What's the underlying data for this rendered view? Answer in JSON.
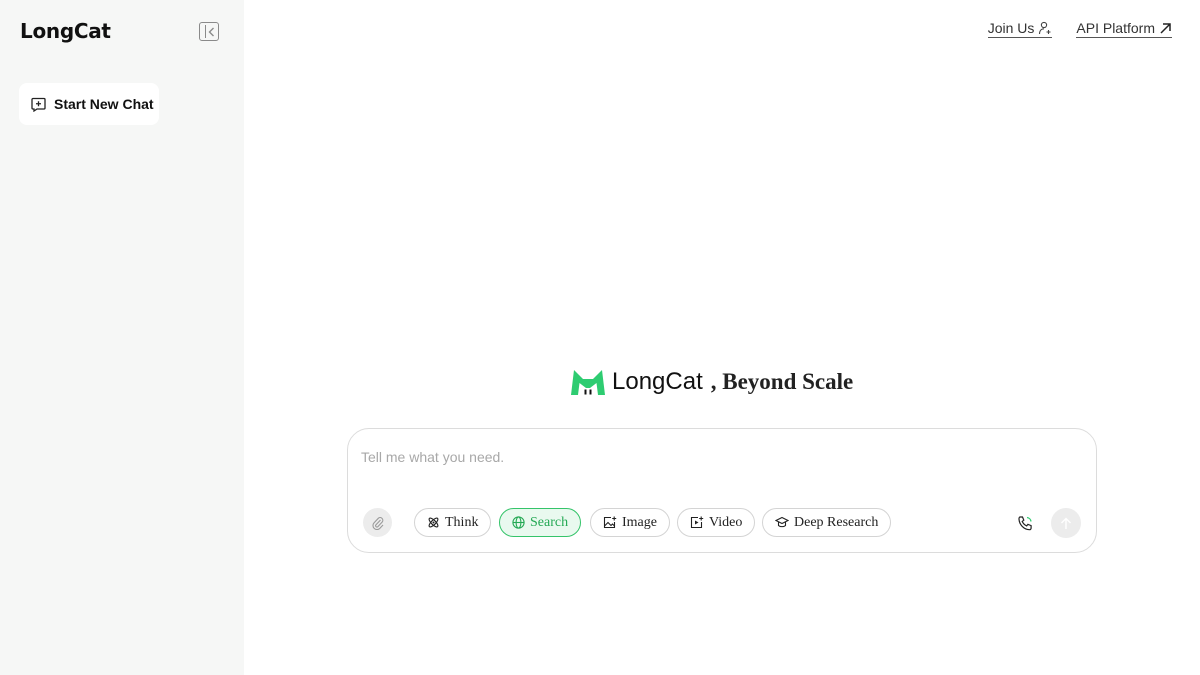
{
  "sidebar": {
    "brand": "LongCat",
    "collapse_icon": "sidebar-collapse-icon",
    "new_chat_label": "Start New Chat",
    "new_chat_icon": "plus-square-icon"
  },
  "topnav": {
    "links": [
      {
        "label": "Join Us",
        "icon": "user-plus-icon"
      },
      {
        "label": "API Platform",
        "icon": "arrow-up-right-icon"
      }
    ]
  },
  "hero": {
    "logo_icon": "longcat-logo-icon",
    "name": "LongCat",
    "tagline": ", Beyond Scale"
  },
  "composer": {
    "placeholder": "Tell me what you need.",
    "value": "",
    "attach_icon": "paperclip-icon",
    "chips": [
      {
        "label": "Think",
        "icon": "atom-icon",
        "active": false
      },
      {
        "label": "Search",
        "icon": "globe-icon",
        "active": true
      },
      {
        "label": "Image",
        "icon": "image-plus-icon",
        "active": false
      },
      {
        "label": "Video",
        "icon": "video-plus-icon",
        "active": false
      },
      {
        "label": "Deep Research",
        "icon": "graduation-cap-icon",
        "active": false
      }
    ],
    "call_icon": "phone-call-icon",
    "send_icon": "arrow-up-icon"
  },
  "colors": {
    "accent": "#35c46a",
    "sidebar_bg": "#f6f7f6"
  }
}
